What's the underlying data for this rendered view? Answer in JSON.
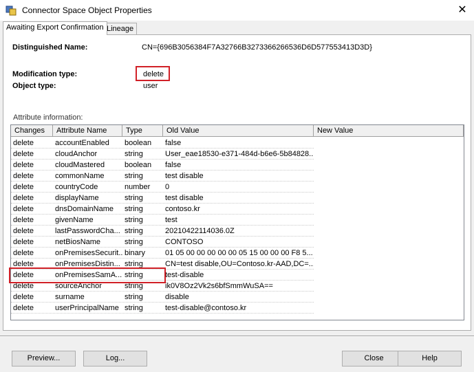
{
  "window": {
    "title": "Connector Space Object Properties",
    "close_glyph": "✕"
  },
  "tabs": [
    {
      "label": "Awaiting Export Confirmation",
      "active": true
    },
    {
      "label": "Lineage",
      "active": false
    }
  ],
  "object": {
    "dn_label": "Distinguished Name:",
    "dn_value": "CN={696B3056384F7A32766B3273366266536D6D577553413D3D}",
    "modtype_label": "Modification type:",
    "modtype_value": "delete",
    "objtype_label": "Object type:",
    "objtype_value": "user"
  },
  "attributes": {
    "section_label": "Attribute information:",
    "columns": [
      "Changes",
      "Attribute Name",
      "Type",
      "Old Value",
      "New Value"
    ],
    "rows": [
      [
        "delete",
        "accountEnabled",
        "boolean",
        "false",
        ""
      ],
      [
        "delete",
        "cloudAnchor",
        "string",
        "User_eae18530-e371-484d-b6e6-5b84828...",
        ""
      ],
      [
        "delete",
        "cloudMastered",
        "boolean",
        "false",
        ""
      ],
      [
        "delete",
        "commonName",
        "string",
        "test disable",
        ""
      ],
      [
        "delete",
        "countryCode",
        "number",
        "0",
        ""
      ],
      [
        "delete",
        "displayName",
        "string",
        "test disable",
        ""
      ],
      [
        "delete",
        "dnsDomainName",
        "string",
        "contoso.kr",
        ""
      ],
      [
        "delete",
        "givenName",
        "string",
        "test",
        ""
      ],
      [
        "delete",
        "lastPasswordCha...",
        "string",
        "20210422114036.0Z",
        ""
      ],
      [
        "delete",
        "netBiosName",
        "string",
        "CONTOSO",
        ""
      ],
      [
        "delete",
        "onPremisesSecurit...",
        "binary",
        "01 05 00 00 00 00 00 05 15 00 00 00 F8 5...",
        ""
      ],
      [
        "delete",
        "onPremisesDistin...",
        "string",
        "CN=test disable,OU=Contoso.kr-AAD,DC=...",
        ""
      ],
      [
        "delete",
        "onPremisesSamA...",
        "string",
        "test-disable",
        ""
      ],
      [
        "delete",
        "sourceAnchor",
        "string",
        "ik0V8Oz2Vk2s6bfSmmWuSA==",
        ""
      ],
      [
        "delete",
        "surname",
        "string",
        "disable",
        ""
      ],
      [
        "delete",
        "userPrincipalName",
        "string",
        "test-disable@contoso.kr",
        ""
      ]
    ]
  },
  "buttons": {
    "preview": "Preview...",
    "log": "Log...",
    "close": "Close",
    "help": "Help"
  },
  "colors": {
    "highlight_border": "#d12027",
    "window_bg": "#f0f0f0"
  }
}
